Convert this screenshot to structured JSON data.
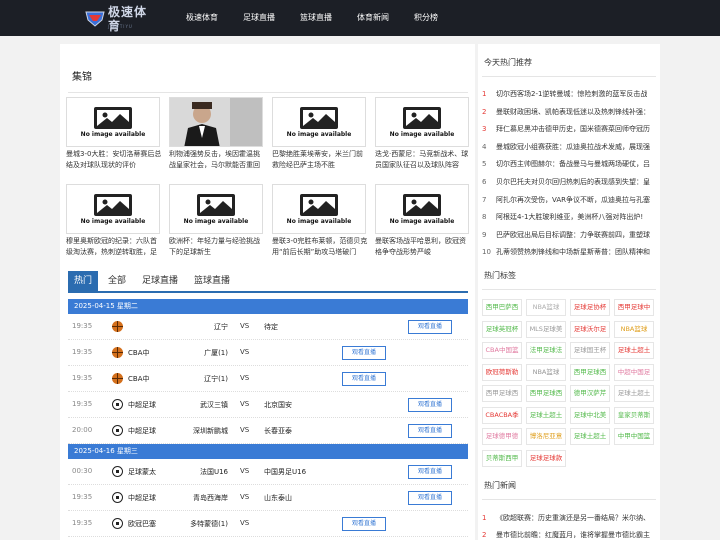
{
  "header": {
    "logo_text": "极速体育",
    "logo_sub": "JISUTIYU",
    "nav": [
      "极速体育",
      "足球直播",
      "篮球直播",
      "体育新闻",
      "积分榜"
    ]
  },
  "gallery": {
    "title": "集锦",
    "no_image_text": "No image available",
    "items": [
      {
        "caption": "曼城3-0大胜：安切洛蒂赛后总结及对球队现状的评价",
        "photo": false
      },
      {
        "caption": "利物浦强势反击，埃因霍温挑战皇家社会，马尔默能否重回",
        "photo": true
      },
      {
        "caption": "巴黎绝胜莱埃蒂安，米兰门前救险经巴萨主场不胜",
        "photo": false
      },
      {
        "caption": "迭戈·西蒙尼：马竞新战术、球员国家队征召以及球队阵容",
        "photo": false
      },
      {
        "caption": "穆里奥斯欧冠的纪录：六队首级淘汰赛，热刺逆转取胜，足",
        "photo": false
      },
      {
        "caption": "欧洲杯：年轻力量与经验挑战下的足球新生",
        "photo": false
      },
      {
        "caption": "曼联3-0完胜布莱顿，范德贝克用“前后长期”助攻马塔破门",
        "photo": false
      },
      {
        "caption": "曼联客场战平哈恩利，欧冠资格争夺战形势严峻",
        "photo": false
      }
    ]
  },
  "tabs": [
    "热门",
    "全部",
    "足球直播",
    "篮球直播"
  ],
  "schedule": {
    "watch_label": "观看直播",
    "vs_label": "VS",
    "days": [
      {
        "date": "2025-04-15 星期二",
        "matches": [
          {
            "time": "19:35",
            "sport": "basketball",
            "league": "",
            "home": "辽宁",
            "away": "待定",
            "btn_pos": "right"
          },
          {
            "time": "19:35",
            "sport": "basketball",
            "league": "CBA中",
            "home": "广厦(1)",
            "away": "",
            "btn_pos": "mid"
          },
          {
            "time": "19:35",
            "sport": "basketball",
            "league": "CBA中",
            "home": "辽宁(1)",
            "away": "",
            "btn_pos": "mid"
          },
          {
            "time": "19:35",
            "sport": "football",
            "league": "中超足球",
            "home": "武汉三镇",
            "away": "北京国安",
            "btn_pos": "right"
          },
          {
            "time": "20:00",
            "sport": "football",
            "league": "中超足球",
            "home": "深圳新鹏城",
            "away": "长春亚泰",
            "btn_pos": "right"
          }
        ]
      },
      {
        "date": "2025-04-16 星期三",
        "matches": [
          {
            "time": "00:30",
            "sport": "football",
            "league": "足球蒙太",
            "home": "法国U16",
            "away": "中国男足U16",
            "btn_pos": "right"
          },
          {
            "time": "19:35",
            "sport": "football",
            "league": "中超足球",
            "home": "青岛西海岸",
            "away": "山东泰山",
            "btn_pos": "right"
          },
          {
            "time": "19:35",
            "sport": "football",
            "league": "欧冠巴塞",
            "home": "多特蒙德(1)",
            "away": "",
            "btn_pos": "mid"
          }
        ]
      }
    ]
  },
  "sidebar": {
    "hot_title": "今天热门推荐",
    "hot_items": [
      "切尔西客场2-1逆转曼城：惊险刺激的蓝军反击战",
      "曼联财政困境、凯帕表现低迷以及热刺锋线补强：",
      "拜仁慕尼黑冲击德甲历史，国米德赛菜回师夺冠历",
      "曼城欧冠小组赛获胜：瓜迪奥拉战术发威，展现强",
      "切尔西主帅图赫尔：备战曼马与曼城两场硬仗，吕",
      "贝尔巴托夫对贝尔回归热刺后的表现感到失望：皇",
      "阿扎尔再次受伤，VAR争议不断，瓜迪奥拉与孔塞",
      "阿根廷4-1大胜玻利维亚，美洲杯八强对阵出炉!",
      "巴萨欧冠出局后目标调整：力争联赛前四，重塑球",
      "孔蒂领赞热刺锋线和中场新星斯蒂普：团队精神和"
    ],
    "tags_title": "热门标签",
    "tags": [
      {
        "label": "西甲巴萨西",
        "color": "#52b94a"
      },
      {
        "label": "NBA篮球",
        "color": "#b0b0b0"
      },
      {
        "label": "足球足协杯",
        "color": "#e53935"
      },
      {
        "label": "西甲足球中",
        "color": "#e53935"
      },
      {
        "label": "足球英冠杯",
        "color": "#52b94a"
      },
      {
        "label": "MLS足球美",
        "color": "#999999"
      },
      {
        "label": "足球沃尔足",
        "color": "#e53935"
      },
      {
        "label": "NBA篮球",
        "color": "#e0a020"
      },
      {
        "label": "CBA中国篮",
        "color": "#e07aa0"
      },
      {
        "label": "法甲足球法",
        "color": "#52b94a"
      },
      {
        "label": "足球国王杯",
        "color": "#999999"
      },
      {
        "label": "足球土超土",
        "color": "#e53935"
      },
      {
        "label": "欧冠荷斯勒",
        "color": "#e53935"
      },
      {
        "label": "NBA篮球",
        "color": "#999999"
      },
      {
        "label": "西甲足球西",
        "color": "#52b94a"
      },
      {
        "label": "中超中国足",
        "color": "#e07aa0"
      },
      {
        "label": "西甲足球西",
        "color": "#999999"
      },
      {
        "label": "西甲足球西",
        "color": "#52b94a"
      },
      {
        "label": "德甲汉萨芹",
        "color": "#52b94a"
      },
      {
        "label": "足球土超土",
        "color": "#999999"
      },
      {
        "label": "CBACBA季",
        "color": "#e53935"
      },
      {
        "label": "足球土超土",
        "color": "#52b94a"
      },
      {
        "label": "足球中北美",
        "color": "#52b94a"
      },
      {
        "label": "皇家贝蒂斯",
        "color": "#52b94a"
      },
      {
        "label": "足球德甲德",
        "color": "#e07aa0"
      },
      {
        "label": "博洛尼亚意",
        "color": "#e0a020"
      },
      {
        "label": "足球土超土",
        "color": "#52b94a"
      },
      {
        "label": "中甲中国篮",
        "color": "#52b94a"
      },
      {
        "label": "贝蒂斯西甲",
        "color": "#52b94a"
      },
      {
        "label": "足球足球款",
        "color": "#e53935"
      }
    ],
    "news_title": "热门新闻",
    "news_items": [
      "《欧超联赛：历史重演还是另一番结局？米尔纳、",
      "曼市德比前瞻：红魔蓝月，谁将掌握曼市德比霸主"
    ]
  }
}
